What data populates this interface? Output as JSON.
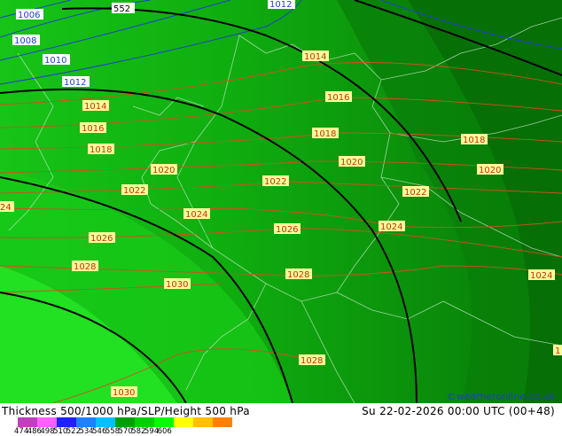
{
  "title": "Thickness 500/1000 hPa/SLP/Height 500 hPa",
  "datetime": "Su 22-02-2026 00:00 UTC (00+48)",
  "credit": "©weatheronline.co.uk",
  "colorbar": {
    "ticks": [
      "474",
      "486",
      "498",
      "510",
      "522",
      "534",
      "546",
      "558",
      "570",
      "582",
      "594",
      "606"
    ],
    "colors": [
      "#c040c0",
      "#ff60ff",
      "#2020ff",
      "#2080ff",
      "#00c0ff",
      "#00a000",
      "#00d000",
      "#00ff00",
      "#ffff00",
      "#ffc000",
      "#ff8000"
    ]
  },
  "labels": {
    "blue": [
      "1006",
      "1008",
      "1010",
      "1012",
      "1012"
    ],
    "black": [
      "552"
    ],
    "red": [
      "1014",
      "1014",
      "1016",
      "1016",
      "1018",
      "1018",
      "1018",
      "1020",
      "1020",
      "1020",
      "1022",
      "1022",
      "1022",
      "24",
      "1024",
      "1024",
      "1024",
      "1026",
      "1026",
      "1028",
      "1028",
      "1028",
      "1030",
      "1030",
      "1"
    ]
  }
}
